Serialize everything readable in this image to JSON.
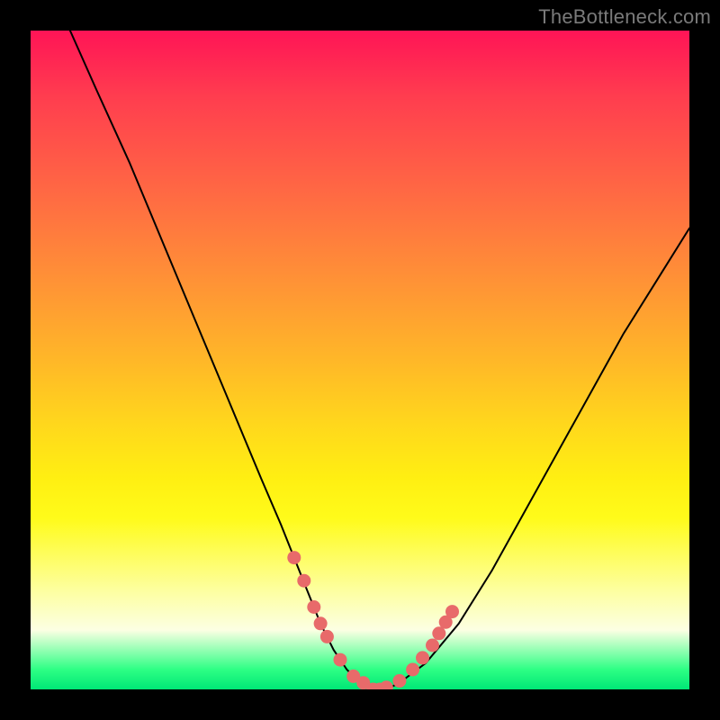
{
  "attribution": "TheBottleneck.com",
  "chart_data": {
    "type": "line",
    "title": "",
    "xlabel": "",
    "ylabel": "",
    "xlim": [
      0,
      100
    ],
    "ylim": [
      0,
      100
    ],
    "grid": false,
    "series": [
      {
        "name": "curve",
        "x": [
          6,
          10,
          15,
          20,
          25,
          30,
          35,
          38,
          40,
          42,
          44,
          46,
          48,
          50,
          52,
          54,
          56,
          60,
          65,
          70,
          75,
          80,
          85,
          90,
          95,
          100
        ],
        "values": [
          100,
          91,
          80,
          68,
          56,
          44,
          32,
          25,
          20,
          15,
          10,
          6,
          3,
          1,
          0,
          0,
          1,
          4,
          10,
          18,
          27,
          36,
          45,
          54,
          62,
          70
        ]
      }
    ],
    "markers": {
      "name": "dots",
      "x": [
        40,
        41.5,
        43,
        44,
        45,
        47,
        49,
        50.5,
        52,
        53,
        54,
        56,
        58,
        59.5,
        61,
        62,
        63,
        64
      ],
      "values": [
        20,
        16.5,
        12.5,
        10,
        8,
        4.5,
        2,
        1,
        0,
        0,
        0.3,
        1.3,
        3.0,
        4.8,
        6.7,
        8.5,
        10.2,
        11.8
      ]
    },
    "colors": {
      "curve": "#000000",
      "markers": "#e86a6a",
      "gradient_top": "#ff1456",
      "gradient_bottom": "#00e676"
    }
  }
}
